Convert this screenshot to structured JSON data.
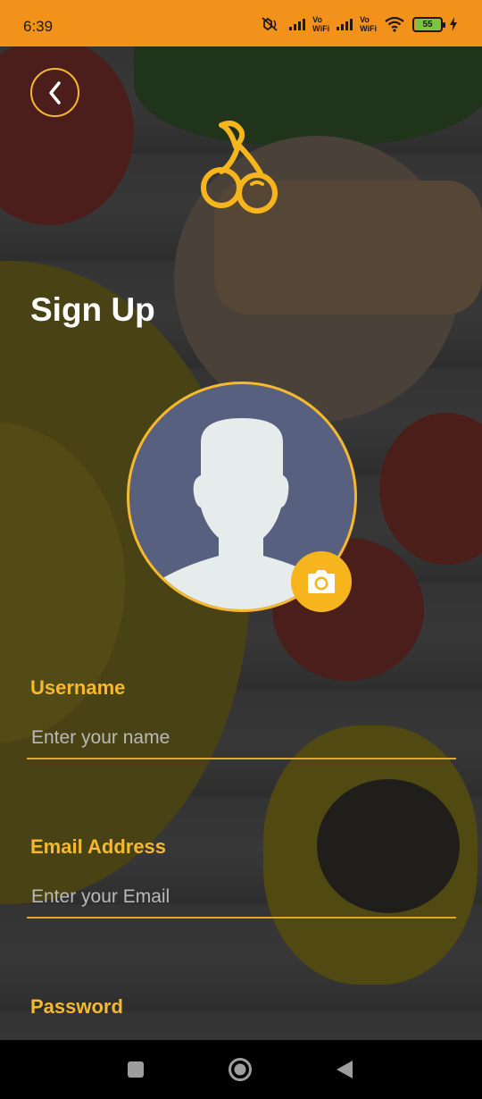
{
  "status_bar": {
    "time": "6:39",
    "wifi_label_1": "Vo",
    "wifi_label_2": "WiFi",
    "battery_level": "55",
    "background_color": "#F2921A"
  },
  "header": {
    "back_icon": "chevron-left-icon",
    "logo_icon": "cherry-icon",
    "title": "Sign Up"
  },
  "avatar": {
    "placeholder_icon": "person-silhouette-icon",
    "camera_icon": "camera-icon"
  },
  "form": {
    "username": {
      "label": "Username",
      "placeholder": "Enter your name"
    },
    "email": {
      "label": "Email Address",
      "placeholder": "Enter your Email"
    },
    "password": {
      "label": "Password"
    }
  },
  "nav_bar": {
    "icons": [
      "square-recents-icon",
      "circle-home-icon",
      "triangle-back-icon"
    ]
  },
  "colors": {
    "accent": "#F5B82E",
    "avatar_bg": "#58607F",
    "camera_button": "#F7B51D"
  }
}
